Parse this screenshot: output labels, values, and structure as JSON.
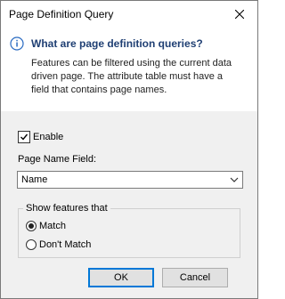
{
  "window": {
    "title": "Page Definition Query"
  },
  "info": {
    "heading": "What are page definition queries?",
    "body": "Features can be filtered using the current data driven page.  The attribute table must have a field that contains page names."
  },
  "enable": {
    "label": "Enable",
    "checked": true
  },
  "page_name_field": {
    "label": "Page Name Field:",
    "value": "Name"
  },
  "show_features": {
    "legend": "Show features that",
    "options": [
      {
        "label": "Match",
        "selected": true
      },
      {
        "label": "Don't Match",
        "selected": false
      }
    ]
  },
  "buttons": {
    "ok": "OK",
    "cancel": "Cancel"
  },
  "colors": {
    "heading": "#1f3f73",
    "info_icon": "#2a6bc2",
    "default_button_border": "#0078d7"
  }
}
